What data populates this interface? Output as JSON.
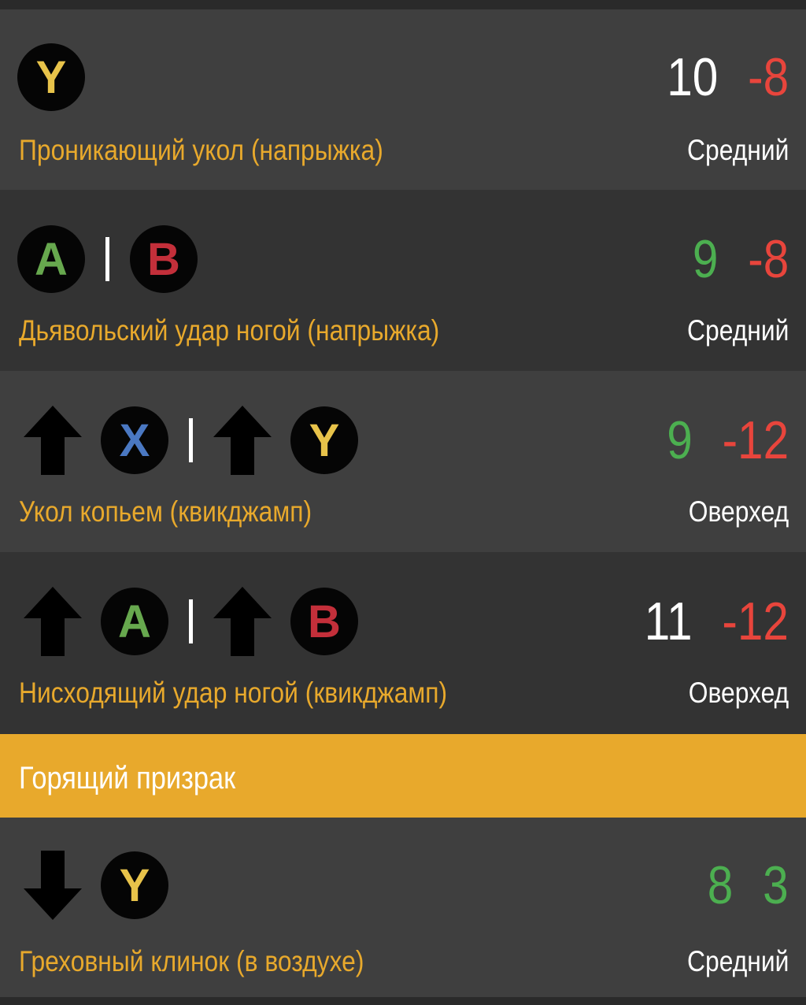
{
  "colors": {
    "button_Y": "#e8c34a",
    "button_A": "#67a84e",
    "button_B": "#c32f3a",
    "button_X": "#4a78c2",
    "move_name": "#e8a92c",
    "hit_level": "#ffffff",
    "frames_plus_neutral": "#ffffff",
    "frames_plus_good": "#4caf50",
    "frames_minus_bad": "#e8453c",
    "section_header_bg": "#e8a92c"
  },
  "moves": [
    {
      "inputs": [
        {
          "type": "button",
          "label": "Y"
        }
      ],
      "startup": "10",
      "on_block": "-8",
      "name": "Проникающий укол  (напрыжка)",
      "hit_level": "Средний"
    },
    {
      "inputs": [
        {
          "type": "button",
          "label": "A"
        },
        {
          "type": "sep"
        },
        {
          "type": "button",
          "label": "B"
        }
      ],
      "startup": "9",
      "on_block": "-8",
      "name": "Дьявольский удар ногой  (напрыжка)",
      "hit_level": "Средний"
    },
    {
      "inputs": [
        {
          "type": "arrow-up"
        },
        {
          "type": "button",
          "label": "X"
        },
        {
          "type": "sep"
        },
        {
          "type": "arrow-up"
        },
        {
          "type": "button",
          "label": "Y"
        }
      ],
      "startup": "9",
      "on_block": "-12",
      "name": "Укол копьем (квикджамп)",
      "hit_level": "Оверхед"
    },
    {
      "inputs": [
        {
          "type": "arrow-up"
        },
        {
          "type": "button",
          "label": "A"
        },
        {
          "type": "sep"
        },
        {
          "type": "arrow-up"
        },
        {
          "type": "button",
          "label": "B"
        }
      ],
      "startup": "11",
      "on_block": "-12",
      "name": "Нисходящий удар ногой (квикджамп)",
      "hit_level": "Оверхед"
    }
  ],
  "section": {
    "title": "Горящий призрак"
  },
  "section_moves": [
    {
      "inputs": [
        {
          "type": "arrow-down"
        },
        {
          "type": "button",
          "label": "Y"
        }
      ],
      "startup": "8",
      "on_block": "3",
      "name": "Греховный клинок (в воздухе)",
      "hit_level": "Средний"
    }
  ]
}
